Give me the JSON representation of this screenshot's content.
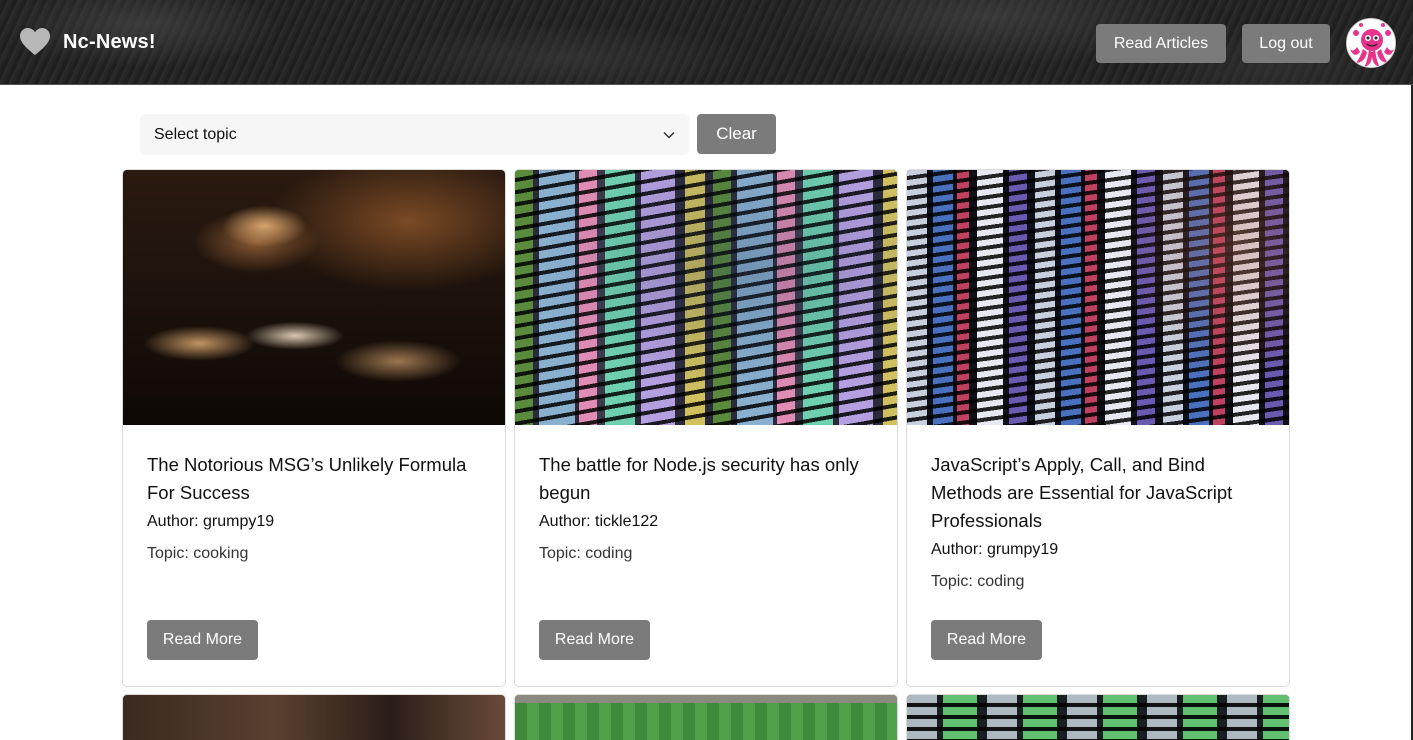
{
  "header": {
    "brand_icon": "heart-icon",
    "brand_title": "Nc-News!",
    "read_articles_label": "Read Articles",
    "logout_label": "Log out",
    "avatar_icon": "pink-octopus-avatar"
  },
  "filter": {
    "select_value": "Select topic",
    "clear_label": "Clear"
  },
  "articles": [
    {
      "title": "The Notorious MSG’s Unlikely Formula For Success",
      "author": "Author: grumpy19",
      "topic": "Topic: cooking",
      "read_more": "Read More",
      "image": "cooking-pan-photo"
    },
    {
      "title": "The battle for Node.js security has only begun",
      "author": "Author: tickle122",
      "topic": "Topic: coding",
      "read_more": "Read More",
      "image": "colorful-code-screen-photo"
    },
    {
      "title": "JavaScript’s Apply, Call, and Bind Methods are Essential for JavaScript Professionals",
      "author": "Author: grumpy19",
      "topic": "Topic: coding",
      "read_more": "Read More",
      "image": "dark-code-screen-photo"
    }
  ],
  "partial_cards": [
    {
      "image": "blurred-food-photo"
    },
    {
      "image": "football-pitch-aerial-photo"
    },
    {
      "image": "terminal-code-photo"
    }
  ],
  "colors": {
    "button_bg": "#7b7b7b",
    "button_text": "#ffffff",
    "header_bg": "#222222",
    "select_bg": "#f6f6f6"
  }
}
